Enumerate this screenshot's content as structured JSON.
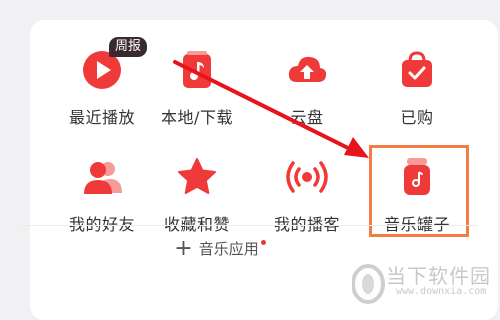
{
  "grid": {
    "row1": [
      {
        "label": "最近播放",
        "icon": "play-icon",
        "badge": "周报"
      },
      {
        "label": "本地/下载",
        "icon": "music-note-icon"
      },
      {
        "label": "云盘",
        "icon": "cloud-upload-icon"
      },
      {
        "label": "已购",
        "icon": "purchased-bag-icon"
      }
    ],
    "row2": [
      {
        "label": "我的好友",
        "icon": "friends-icon"
      },
      {
        "label": "收藏和赞",
        "icon": "star-icon"
      },
      {
        "label": "我的播客",
        "icon": "broadcast-icon"
      },
      {
        "label": "音乐罐子",
        "icon": "music-jar-icon"
      }
    ]
  },
  "footer": {
    "label": "音乐应用",
    "plus": "+"
  },
  "watermark": {
    "text": "当下软件园",
    "url": "www.downxia.com"
  },
  "colors": {
    "accent": "#f03a3a",
    "highlight": "#f47c44",
    "arrow": "#e8141c"
  }
}
